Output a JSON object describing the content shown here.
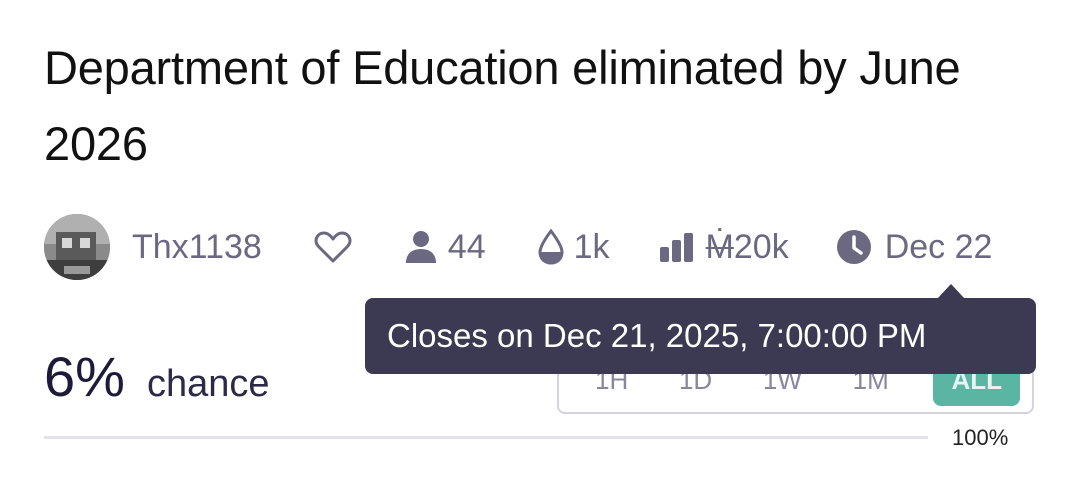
{
  "market": {
    "title": "Department of Education eliminated by June 2026",
    "creator": "Thx1138",
    "traders": "44",
    "liquidity": "1k",
    "volume_symbol": "Ṁ",
    "volume": "20k",
    "close_date": "Dec 22",
    "probability": "6%",
    "probability_label": "chance"
  },
  "tooltip": {
    "text": "Closes on Dec 21, 2025, 7:00:00 PM"
  },
  "time_range": {
    "options": [
      "1H",
      "1D",
      "1W",
      "1M",
      "ALL"
    ],
    "selected": "ALL"
  },
  "chart": {
    "y_max_label": "100%"
  },
  "colors": {
    "accent_teal": "#5ab5a3",
    "tooltip_bg": "#3b3a52",
    "meta_text": "#6b6882"
  },
  "icons": [
    "avatar",
    "heart-icon",
    "user-icon",
    "droplet-icon",
    "bar-chart-icon",
    "clock-icon"
  ]
}
